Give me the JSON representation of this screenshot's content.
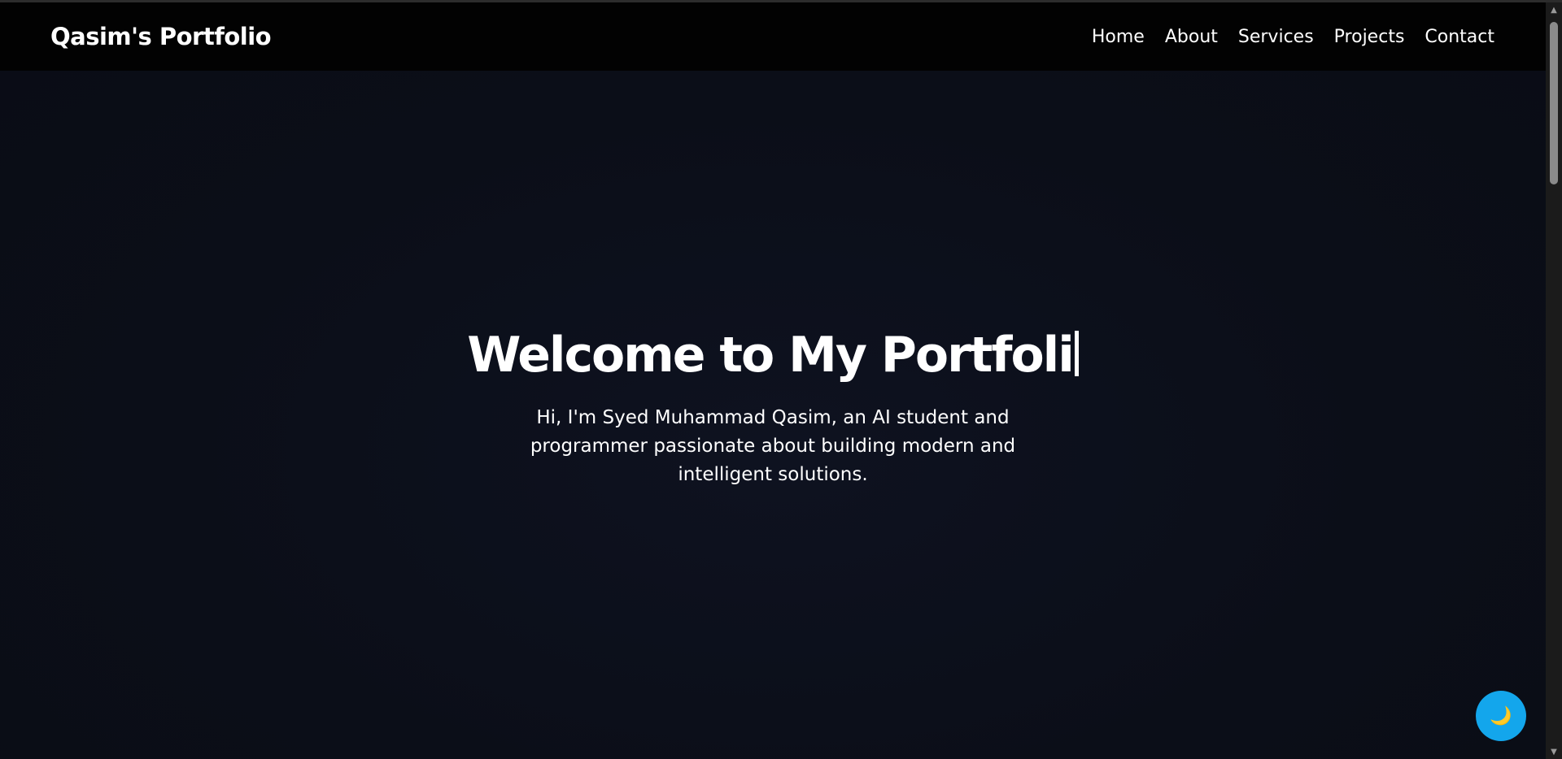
{
  "header": {
    "logo": "Qasim's Portfolio",
    "nav": [
      {
        "label": "Home"
      },
      {
        "label": "About"
      },
      {
        "label": "Services"
      },
      {
        "label": "Projects"
      },
      {
        "label": "Contact"
      }
    ]
  },
  "hero": {
    "title": "Welcome to My Portfoli",
    "subtitle": "Hi, I'm Syed Muhammad Qasim, an AI student and programmer passionate about building modern and intelligent solutions."
  },
  "theme_toggle": {
    "icon": "moon-icon",
    "glyph": "🌙"
  },
  "colors": {
    "background": "#0b0e18",
    "navbar": "#020202",
    "accent": "#13a6ec",
    "text": "#ffffff"
  }
}
